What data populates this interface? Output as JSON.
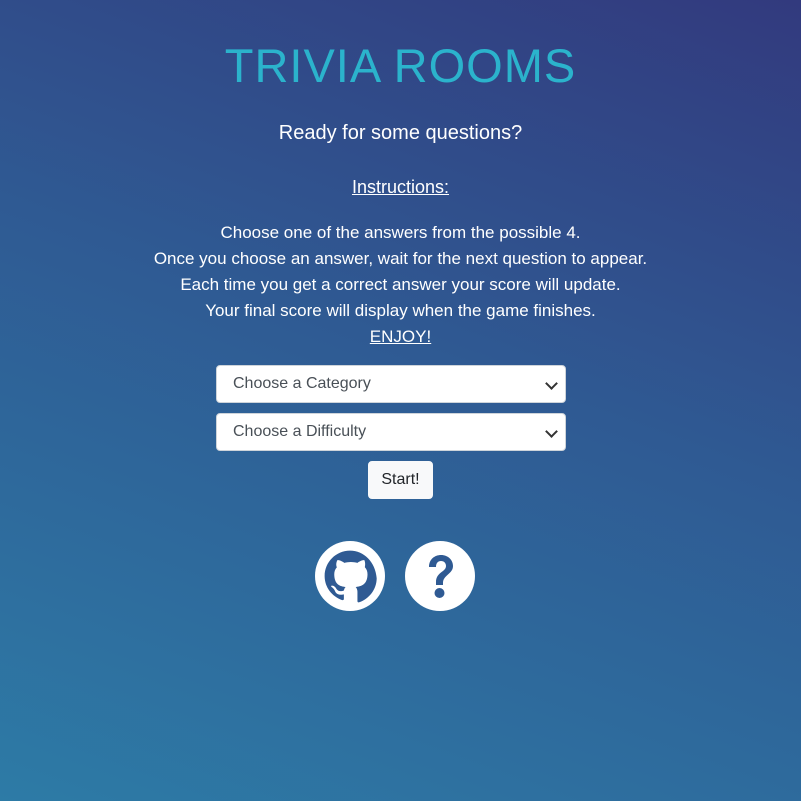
{
  "header": {
    "title": "TRIVIA ROOMS",
    "subtitle": "Ready for some questions?"
  },
  "instructions": {
    "heading": "Instructions:",
    "lines": [
      "Choose one of the answers from the possible 4.",
      "Once you choose an answer, wait for the next question to appear.",
      "Each time you get a correct answer your score will update.",
      "Your final score will display when the game finishes."
    ],
    "closing": "ENJOY!"
  },
  "form": {
    "category_select": {
      "selected": "Choose a Category"
    },
    "difficulty_select": {
      "selected": "Choose a Difficulty"
    },
    "start_label": "Start!"
  },
  "footer_icons": [
    {
      "name": "github-icon"
    },
    {
      "name": "help-icon"
    }
  ],
  "colors": {
    "title": "#2bb3cc",
    "background_top": "#323a7e",
    "background_bottom": "#2d7ba6",
    "icon_fill": "#ffffff"
  }
}
